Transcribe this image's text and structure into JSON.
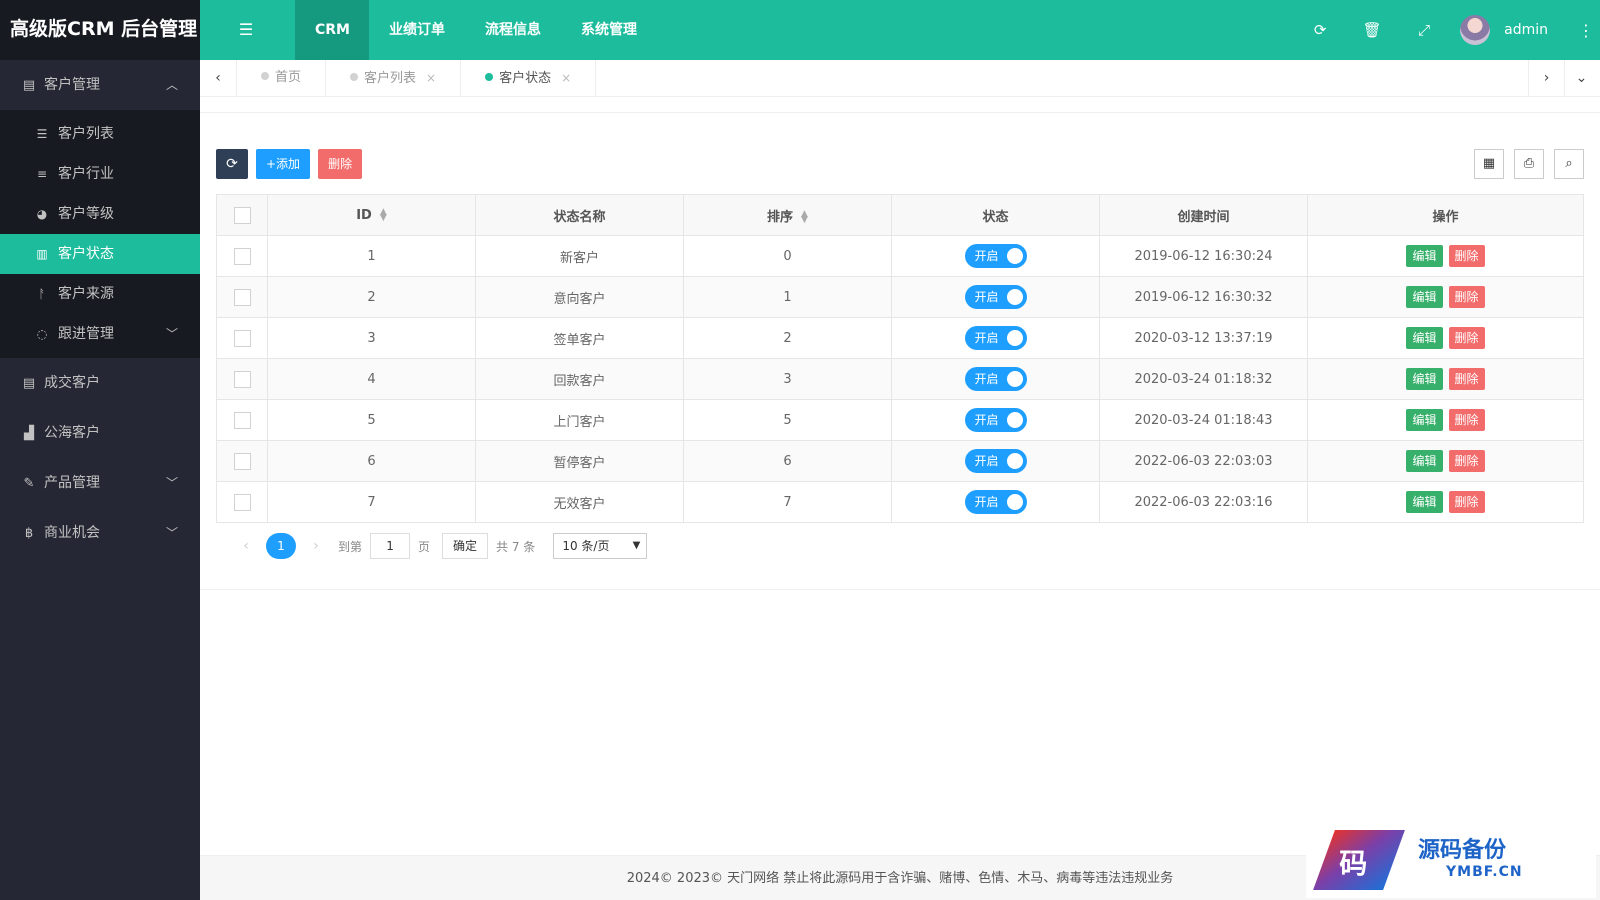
{
  "app": {
    "logo_text": "高级版CRM 后台管理",
    "accent_color": "#1cbc9c",
    "dark_color": "#252834"
  },
  "topnav": {
    "menu_icon": "menu-icon",
    "items": [
      {
        "label": "CRM",
        "active": true
      },
      {
        "label": "业绩订单"
      },
      {
        "label": "流程信息"
      },
      {
        "label": "系统管理"
      }
    ],
    "icons": [
      "refresh-icon",
      "trash-icon",
      "fullscreen-icon"
    ],
    "username": "admin"
  },
  "sidebar": {
    "groups": [
      {
        "label": "客户管理",
        "icon": "id-card-icon",
        "expanded": true,
        "children": [
          {
            "label": "客户列表",
            "icon": "list-icon"
          },
          {
            "label": "客户行业",
            "icon": "align-icon"
          },
          {
            "label": "客户等级",
            "icon": "dashboard-icon"
          },
          {
            "label": "客户状态",
            "icon": "newspaper-icon",
            "active": true
          },
          {
            "label": "客户来源",
            "icon": "walk-icon"
          },
          {
            "label": "跟进管理",
            "icon": "chat-icon"
          }
        ]
      },
      {
        "label": "成交客户",
        "icon": "id-card-icon"
      },
      {
        "label": "公海客户",
        "icon": "bar-chart-icon"
      },
      {
        "label": "产品管理",
        "icon": "brush-icon"
      },
      {
        "label": "商业机会",
        "icon": "bitcoin-icon"
      }
    ]
  },
  "tabs": [
    {
      "label": "首页",
      "closable": false
    },
    {
      "label": "客户列表",
      "closable": true
    },
    {
      "label": "客户状态",
      "closable": true,
      "active": true
    }
  ],
  "toolbar": {
    "refresh_icon": "refresh-icon",
    "add_label": "+添加",
    "delete_label": "删除"
  },
  "table": {
    "columns": [
      "ID",
      "状态名称",
      "排序",
      "状态",
      "创建时间",
      "操作"
    ],
    "rows": [
      {
        "id": "1",
        "name": "新客户",
        "sort": "0",
        "status": "开启",
        "created": "2019-06-12 16:30:24"
      },
      {
        "id": "2",
        "name": "意向客户",
        "sort": "1",
        "status": "开启",
        "created": "2019-06-12 16:30:32"
      },
      {
        "id": "3",
        "name": "签单客户",
        "sort": "2",
        "status": "开启",
        "created": "2020-03-12 13:37:19"
      },
      {
        "id": "4",
        "name": "回款客户",
        "sort": "3",
        "status": "开启",
        "created": "2020-03-24 01:18:32"
      },
      {
        "id": "5",
        "name": "上门客户",
        "sort": "5",
        "status": "开启",
        "created": "2020-03-24 01:18:43"
      },
      {
        "id": "6",
        "name": "暂停客户",
        "sort": "6",
        "status": "开启",
        "created": "2022-06-03 22:03:03"
      },
      {
        "id": "7",
        "name": "无效客户",
        "sort": "7",
        "status": "开启",
        "created": "2022-06-03 22:03:16"
      }
    ],
    "edit_label": "编辑",
    "delete_label": "删除"
  },
  "pager": {
    "current": "1",
    "goto_prefix": "到第",
    "goto_value": "1",
    "goto_suffix": "页",
    "confirm_label": "确定",
    "total": "共 7 条",
    "page_size": "10 条/页"
  },
  "footer": {
    "text": "2024© 2023© 天门网络 禁止将此源码用于含诈骗、赌博、色情、木马、病毒等违法违规业务"
  },
  "watermark": {
    "logo_char": "码",
    "title": "源码备份",
    "domain": "YMBF.CN"
  }
}
